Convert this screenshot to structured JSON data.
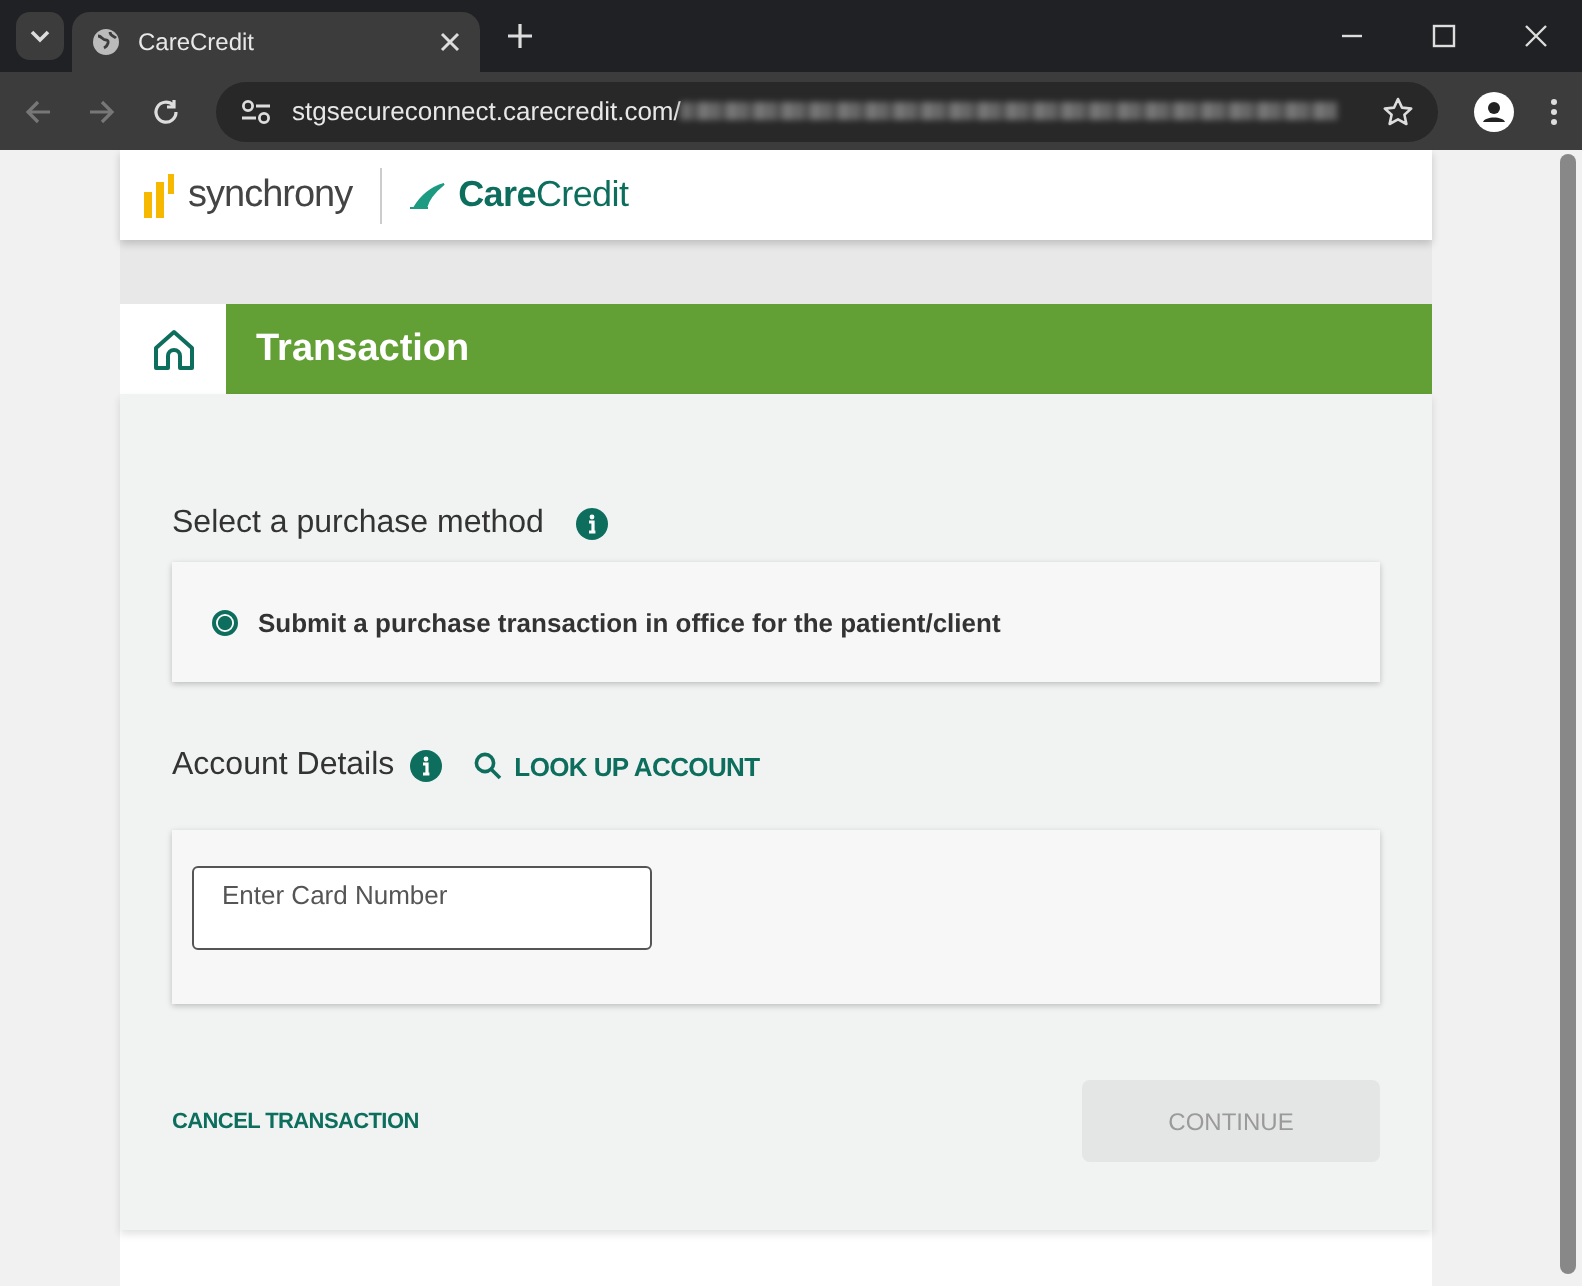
{
  "browser": {
    "tab": {
      "title": "CareCredit"
    },
    "address": "stgsecureconnect.carecredit.com/"
  },
  "header": {
    "brand": "synchrony",
    "partner": "**Care**Credit"
  },
  "page": {
    "title": "Transaction"
  },
  "purchase_method": {
    "heading": "Select a purchase method",
    "options": [
      {
        "label": "Submit a purchase transaction in office for the patient/client",
        "selected": true
      }
    ]
  },
  "account": {
    "heading": "Account Details",
    "lookup": "LOOK UP ACCOUNT",
    "card_field": {
      "placeholder": "Enter Card Number"
    }
  },
  "actions": {
    "cancel": "CANCEL TRANSACTION",
    "continue": {
      "label": "CONTINUE",
      "disabled": true
    }
  }
}
